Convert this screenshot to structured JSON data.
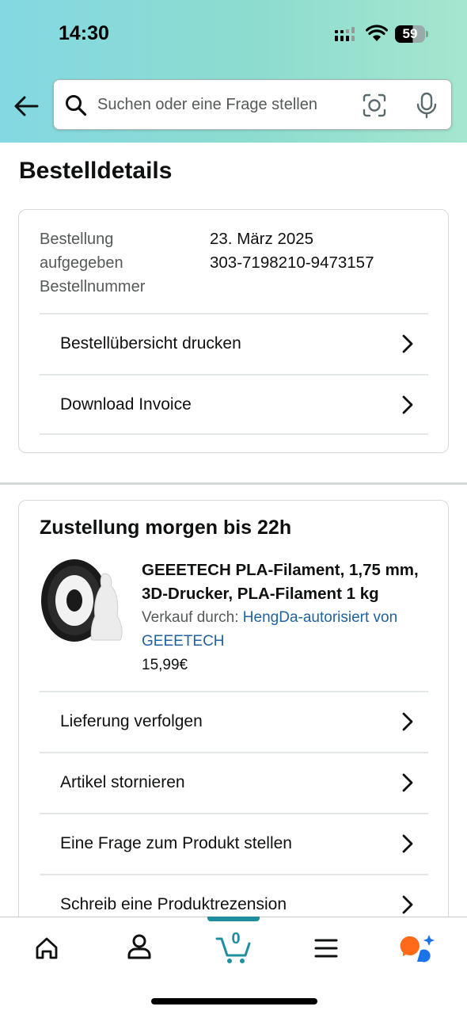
{
  "status_bar": {
    "time": "14:30",
    "battery": "59"
  },
  "search": {
    "placeholder": "Suchen oder eine Frage stellen"
  },
  "page": {
    "title": "Bestelldetails"
  },
  "order_info": {
    "label_lines": [
      "Bestellung",
      "aufgegeben",
      "Bestellnummer"
    ],
    "date": "23. März 2025",
    "order_number": "303-7198210-9473157"
  },
  "order_actions": [
    {
      "label": "Bestellübersicht drucken"
    },
    {
      "label": "Download Invoice"
    }
  ],
  "shipment": {
    "title": "Zustellung morgen bis 22h",
    "product_title": "GEEETECH PLA-Filament, 1,75 mm, 3D-Drucker, PLA-Filament 1 kg",
    "seller_prefix": "Verkauf durch: ",
    "seller_name": "HengDa-autorisiert von GEEETECH",
    "price": "15,99€",
    "actions": [
      {
        "label": "Lieferung verfolgen"
      },
      {
        "label": "Artikel stornieren"
      },
      {
        "label": "Eine Frage zum Produkt stellen"
      },
      {
        "label": "Schreib eine Produktrezension"
      }
    ]
  },
  "bottom_nav": {
    "items": [
      "home-icon",
      "account-icon",
      "cart-icon",
      "menu-icon",
      "assistant-icon"
    ],
    "cart_count": "0",
    "active": "cart",
    "accent_color": "#1f8fa0"
  }
}
